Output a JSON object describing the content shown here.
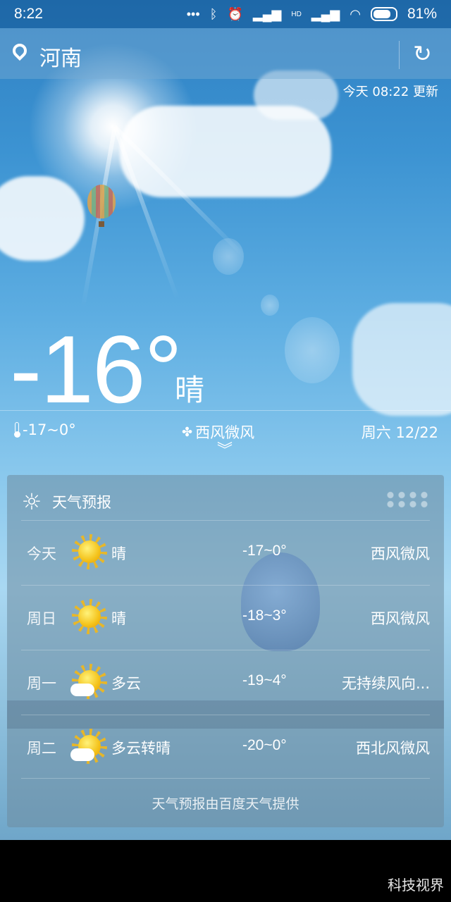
{
  "status_bar": {
    "time": "8:22",
    "network_label": "HD",
    "battery_percent": "81%"
  },
  "header": {
    "location": "河南",
    "updated": "今天 08:22 更新"
  },
  "current": {
    "temperature": "-16°",
    "condition": "晴",
    "range": "-17~0°",
    "wind": "西风微风",
    "date": "周六 12/22"
  },
  "forecast": {
    "title": "天气预报",
    "rows": [
      {
        "day": "今天",
        "icon": "sunny-icon",
        "condition": "晴",
        "temp": "-17~0°",
        "wind": "西风微风"
      },
      {
        "day": "周日",
        "icon": "sunny-icon",
        "condition": "晴",
        "temp": "-18~3°",
        "wind": "西风微风"
      },
      {
        "day": "周一",
        "icon": "partly-cloudy-icon",
        "condition": "多云",
        "temp": "-19~4°",
        "wind": "无持续风向..."
      },
      {
        "day": "周二",
        "icon": "partly-cloudy-icon",
        "condition": "多云转晴",
        "temp": "-20~0°",
        "wind": "西北风微风"
      }
    ],
    "credit": "天气预报由百度天气提供"
  },
  "watermark": "科技视界"
}
